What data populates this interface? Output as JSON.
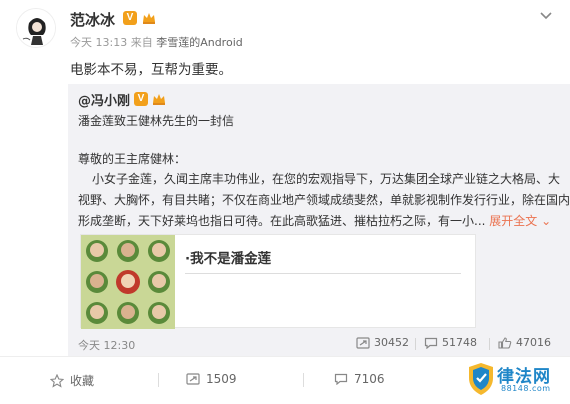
{
  "post": {
    "author": "范冰冰",
    "verified_badge": "V",
    "meta_time": "今天 13:13",
    "meta_from": "来自",
    "meta_source": "李雪莲的Android",
    "text": "电影本不易，互帮为重要。"
  },
  "repost": {
    "author": "@冯小刚",
    "verified_badge": "V",
    "subtitle": "潘金莲致王健林先生的一封信",
    "greeting": "尊敬的王主席健林：",
    "lines": [
      "小女子金莲，久闻主席丰功伟业，在您的宏观指导下，万达集团全球产业链之大格局、大",
      "视野、大胸怀，有目共睹；不仅在商业地产领域成绩斐然，单就影视制作发行行业，除在国内",
      "形成垄断，天下好莱坞也指日可待。在此高歌猛进、摧枯拉朽之际，有一小..."
    ],
    "expand_label": "展开全文",
    "card_title": "·我不是潘金莲",
    "time": "今天 12:30",
    "reposts": "30452",
    "comments": "51748",
    "likes": "47016"
  },
  "actions": {
    "favorite": "收藏",
    "repost": "1509",
    "comment": "7106"
  },
  "watermark": {
    "text": "律法网",
    "url": "88148.com"
  },
  "colors": {
    "accent": "#eb7350",
    "badge": "#f2a01b",
    "repost_bg": "#f2f2f5",
    "watermark": "#1f86c8"
  },
  "icons": [
    "chevron-down-icon",
    "crown-icon",
    "repost-icon",
    "comment-icon",
    "like-icon",
    "star-icon"
  ]
}
